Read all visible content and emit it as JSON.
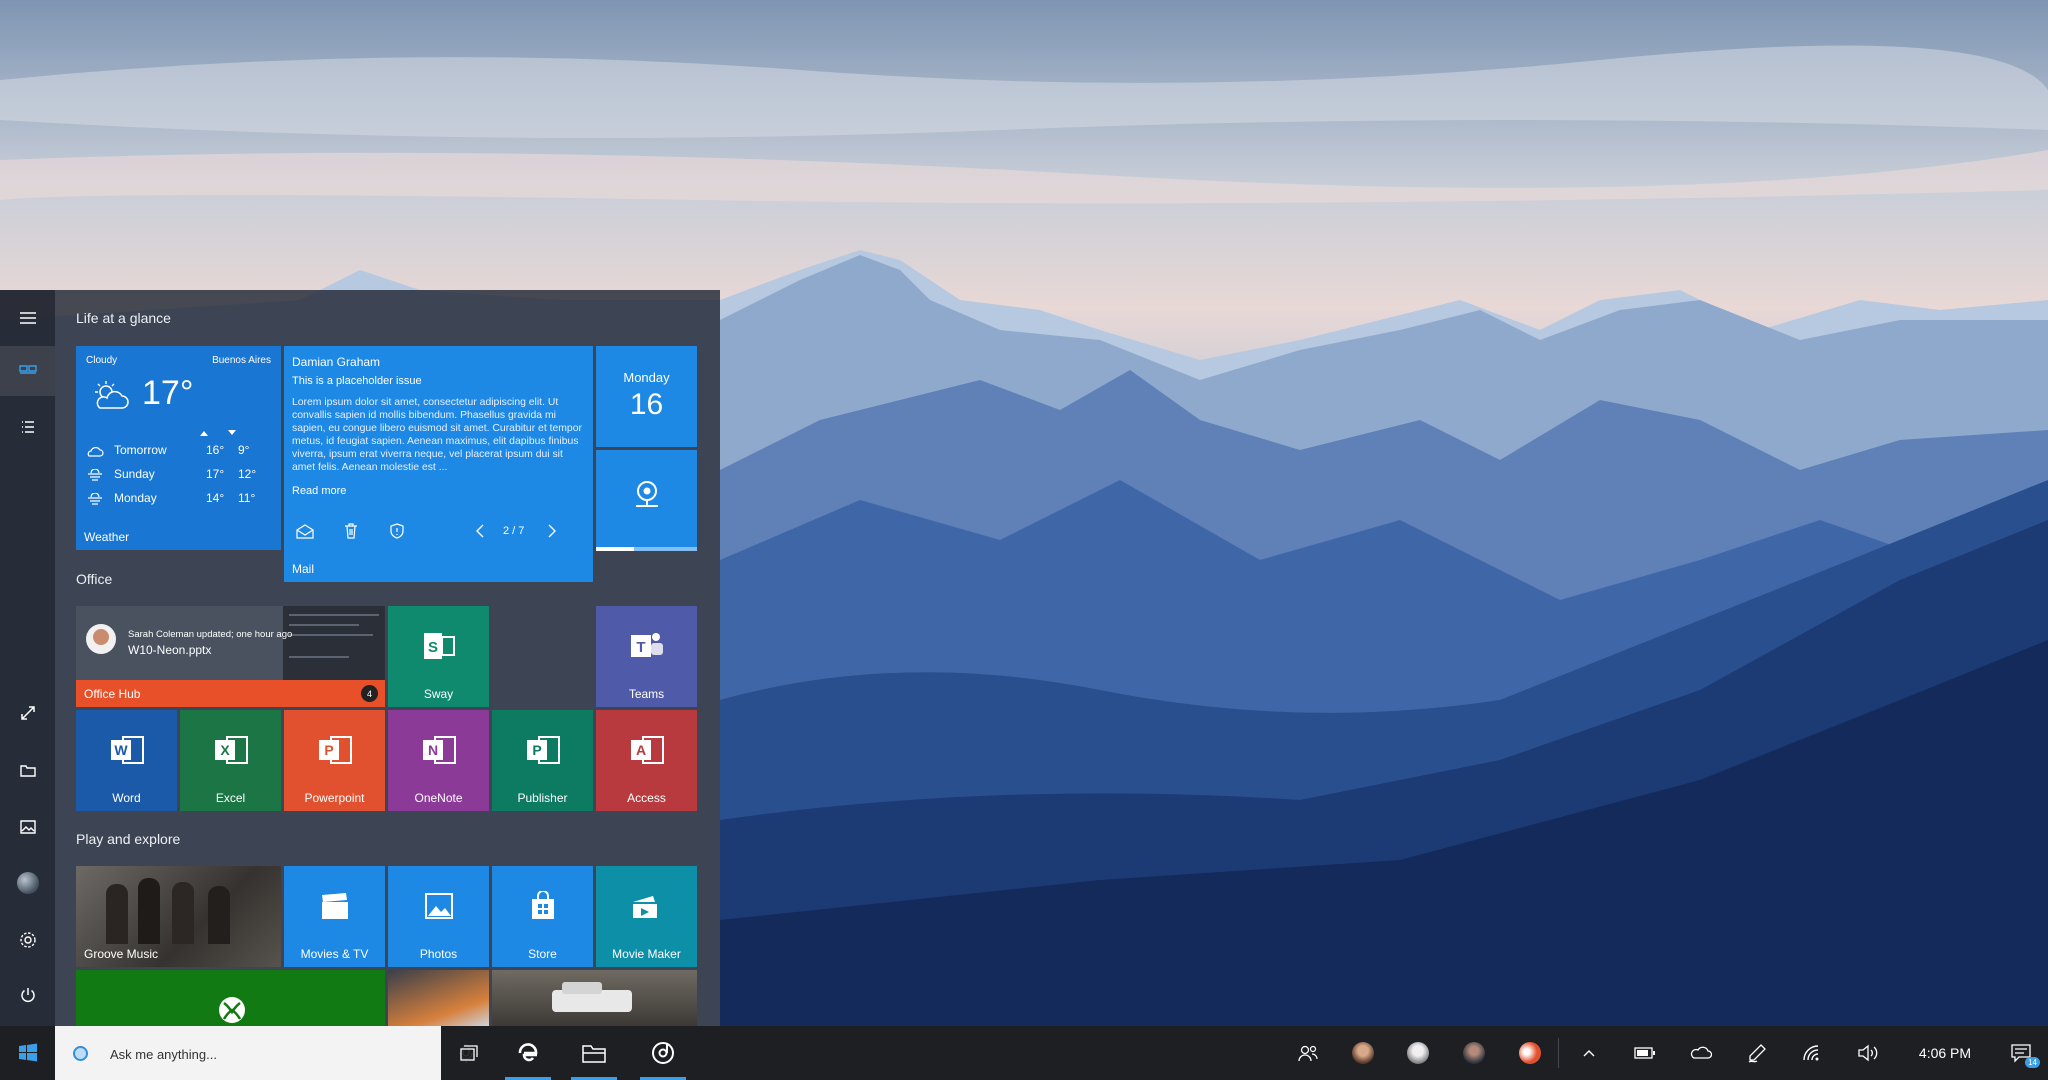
{
  "start": {
    "groups": {
      "life": "Life at a glance",
      "office": "Office",
      "play": "Play and explore"
    },
    "weather": {
      "condition": "Cloudy",
      "city": "Buenos Aires",
      "temp": "17°",
      "label": "Weather",
      "forecast": [
        {
          "day": "Tomorrow",
          "high": "16°",
          "low": "9°"
        },
        {
          "day": "Sunday",
          "high": "17°",
          "low": "12°"
        },
        {
          "day": "Monday",
          "high": "14°",
          "low": "11°"
        }
      ]
    },
    "mail": {
      "from": "Damian Graham",
      "subject": "This is a placeholder issue",
      "body": "Lorem ipsum dolor sit amet, consectetur adipiscing elit. Ut convallis sapien id mollis bibendum. Phasellus gravida mi sapien, eu congue libero euismod sit amet. Curabitur et tempor metus, id feugiat sapien. Aenean maximus, elit dapibus finibus viverra, ipsum erat viverra neque, vel placerat ipsum dui sit amet felis. Aenean molestie est ...",
      "read_more": "Read more",
      "page": "2 / 7",
      "label": "Mail"
    },
    "calendar": {
      "day": "Monday",
      "date": "16"
    },
    "office_hub": {
      "activity": "Sarah Coleman updated; one hour ago",
      "file": "W10-Neon.pptx",
      "label": "Office Hub",
      "badge": "4"
    },
    "tiles": {
      "sway": "Sway",
      "teams": "Teams",
      "word": "Word",
      "excel": "Excel",
      "powerpoint": "Powerpoint",
      "onenote": "OneNote",
      "publisher": "Publisher",
      "access": "Access",
      "groove": "Groove Music",
      "movies": "Movies & TV",
      "photos": "Photos",
      "store": "Store",
      "moviemaker": "Movie Maker"
    }
  },
  "taskbar": {
    "search_placeholder": "Ask me anything...",
    "time": "4:06 PM",
    "notification_count": "14"
  },
  "colors": {
    "accent": "#1e88e5",
    "tile_blue": "#1976d2",
    "sway": "#0f8a6e",
    "teams": "#4f5aa8",
    "word": "#1a5aa8",
    "excel": "#1c7544",
    "powerpoint": "#e2512f",
    "onenote": "#8b3a97",
    "publisher": "#0d7a62",
    "access": "#b83a3f",
    "office_hub": "#e8502a",
    "xbox": "#127a12"
  }
}
